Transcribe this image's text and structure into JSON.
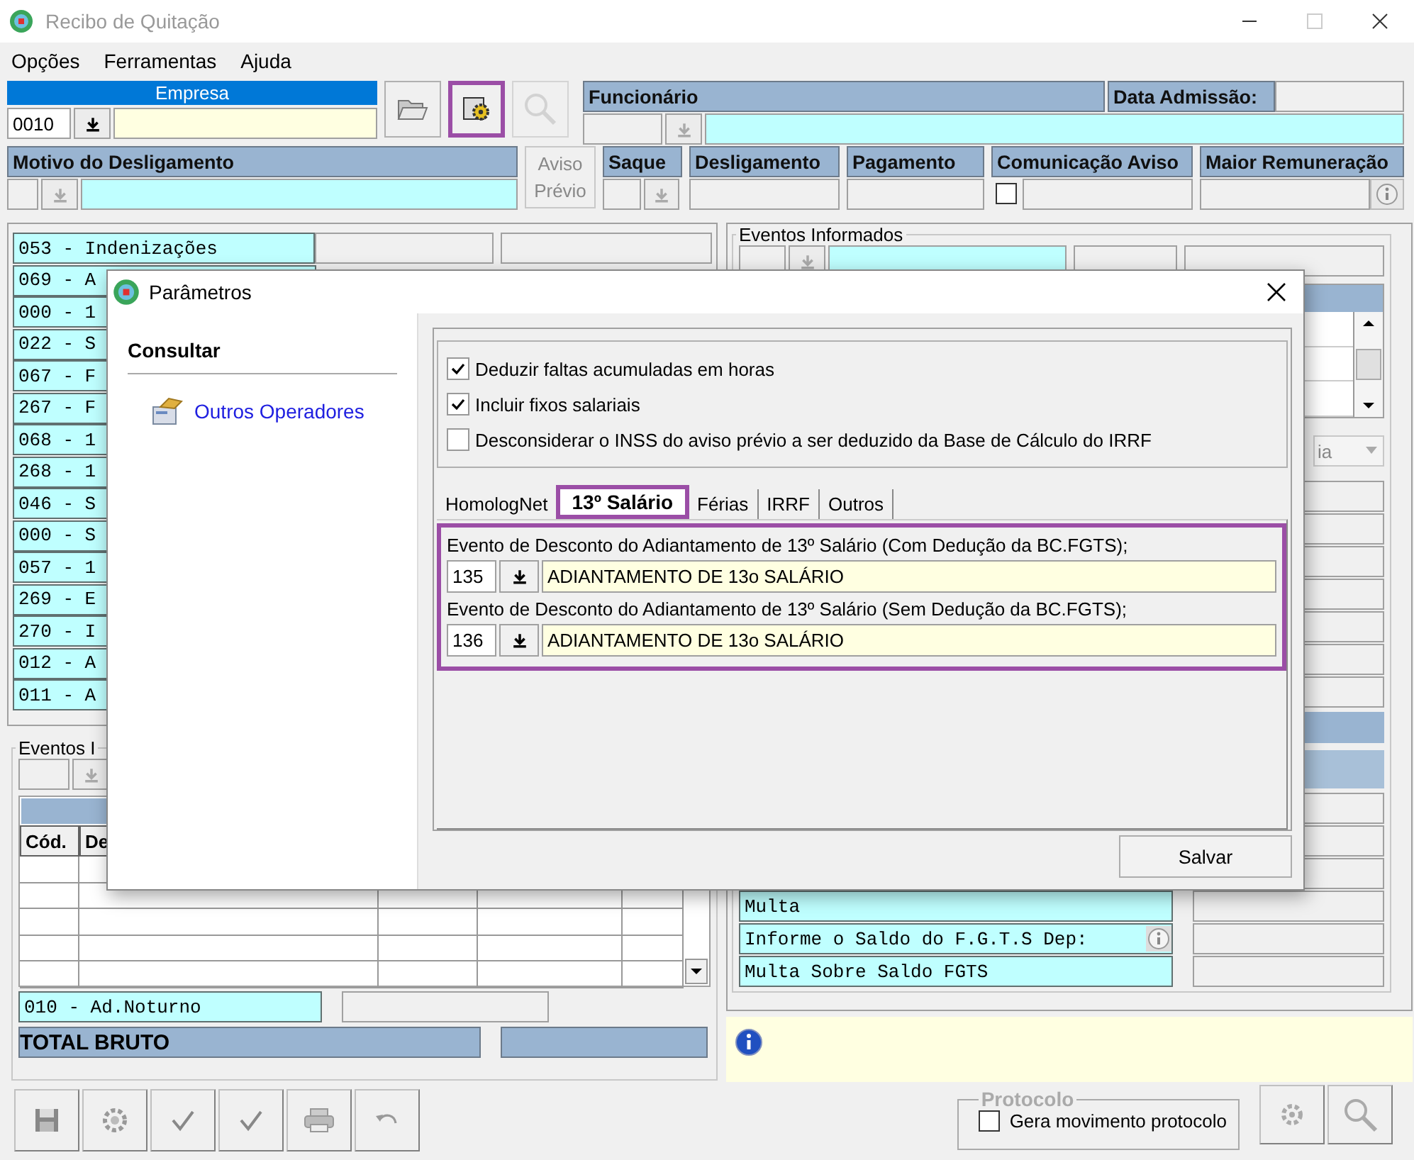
{
  "window": {
    "title": "Recibo de Quitação"
  },
  "menu": [
    "Opções",
    "Ferramentas",
    "Ajuda"
  ],
  "empresa": {
    "label": "Empresa",
    "code": "0010"
  },
  "toolbar": [
    {
      "kind": "folder",
      "disabled": false,
      "highlighted": false
    },
    {
      "kind": "gear",
      "disabled": false,
      "highlighted": true
    },
    {
      "kind": "search",
      "disabled": true,
      "highlighted": false
    }
  ],
  "funcionario": {
    "label": "Funcionário",
    "admissao_label": "Data Admissão:"
  },
  "motivo": {
    "label": "Motivo do Desligamento"
  },
  "aviso_button": "Aviso Prévio",
  "date_fields": [
    {
      "label": "Saque",
      "kind": "lookup"
    },
    {
      "label": "Desligamento",
      "kind": "plain"
    },
    {
      "label": "Pagamento",
      "kind": "plain"
    },
    {
      "label": "Comunicação Aviso",
      "kind": "checkbox",
      "checked": false
    },
    {
      "label": "Maior Remuneração",
      "kind": "info"
    }
  ],
  "verbas": [
    "053 - Indenizações",
    "069 - A",
    "000 - 1",
    "022 - S",
    "067 - F",
    "267 - F",
    "068 - 1",
    "268 - 1",
    "046 - S",
    "000 - S",
    "057 - 1",
    "269 - E",
    "270 - I",
    "012 - A",
    "011 - A"
  ],
  "eventos": {
    "legend": "Eventos I",
    "columns": [
      "Cód.",
      "De"
    ],
    "footer_item": "010 - Ad.Noturno",
    "total_label": "TOTAL BRUTO"
  },
  "action_buttons": [
    {
      "kind": "save"
    },
    {
      "kind": "cog"
    },
    {
      "kind": "check"
    },
    {
      "kind": "check"
    },
    {
      "kind": "print"
    },
    {
      "kind": "undo"
    }
  ],
  "eventos_informados": {
    "legend": "Eventos Informados",
    "combo_value": "ia"
  },
  "fgts_rows": [
    {
      "label": "Multa",
      "info": false
    },
    {
      "label": "Informe o Saldo do F.G.T.S Dep:",
      "info": true
    },
    {
      "label": "Multa Sobre Saldo FGTS",
      "info": false
    }
  ],
  "protocolo": {
    "legend": "Protocolo",
    "label": "Gera movimento protocolo",
    "checked": false
  },
  "bottom_buttons": [
    {
      "kind": "gear"
    },
    {
      "kind": "search"
    }
  ],
  "dialog": {
    "title": "Parâmetros",
    "heading": "Consultar",
    "link": "Outros Operadores",
    "options": [
      {
        "label": "Deduzir faltas acumuladas em horas",
        "checked": true
      },
      {
        "label": "Incluir fixos salariais",
        "checked": true
      },
      {
        "label": "Desconsiderar o INSS do aviso prévio a ser deduzido da Base de Cálculo do IRRF",
        "checked": false
      }
    ],
    "tabs": [
      {
        "label": "HomologNet",
        "selected": false
      },
      {
        "label": "13º Salário",
        "selected": true
      },
      {
        "label": "Férias",
        "selected": false
      },
      {
        "label": "IRRF",
        "selected": false
      },
      {
        "label": "Outros",
        "selected": false
      }
    ],
    "tab_content": {
      "highlighted": true,
      "events": [
        {
          "label": "Evento de Desconto do Adiantamento de 13º Salário (Com Dedução da BC.FGTS);",
          "code": "135",
          "description": "ADIANTAMENTO DE 13o SALÁRIO"
        },
        {
          "label": "Evento de Desconto do Adiantamento de 13º Salário (Sem Dedução da BC.FGTS);",
          "code": "136",
          "description": "ADIANTAMENTO DE 13o SALÁRIO"
        }
      ]
    },
    "save_button": "Salvar"
  }
}
